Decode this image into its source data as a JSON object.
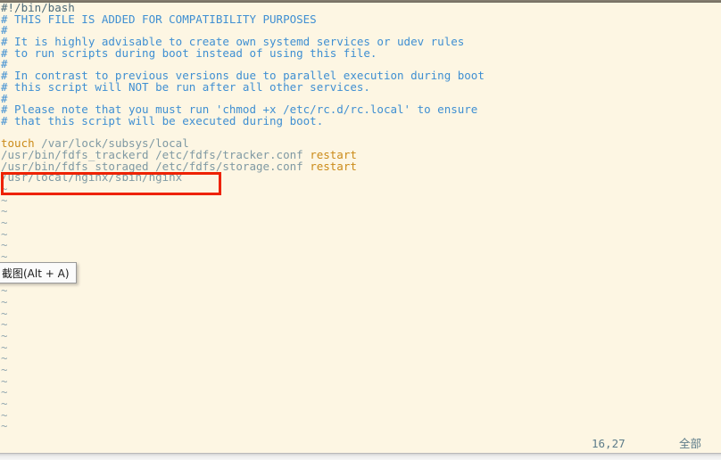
{
  "editor": {
    "name": "vim",
    "background_color": "#fdf6e3",
    "lines": [
      {
        "kind": "shebang",
        "text": "#!/bin/bash"
      },
      {
        "kind": "comment",
        "text": "# THIS FILE IS ADDED FOR COMPATIBILITY PURPOSES"
      },
      {
        "kind": "comment",
        "text": "#"
      },
      {
        "kind": "comment",
        "text": "# It is highly advisable to create own systemd services or udev rules"
      },
      {
        "kind": "comment",
        "text": "# to run scripts during boot instead of using this file."
      },
      {
        "kind": "comment",
        "text": "#"
      },
      {
        "kind": "comment",
        "text": "# In contrast to previous versions due to parallel execution during boot"
      },
      {
        "kind": "comment",
        "text": "# this script will NOT be run after all other services."
      },
      {
        "kind": "comment",
        "text": "#"
      },
      {
        "kind": "comment",
        "text": "# Please note that you must run 'chmod +x /etc/rc.d/rc.local' to ensure"
      },
      {
        "kind": "comment",
        "text": "# that this script will be executed during boot."
      },
      {
        "kind": "blank",
        "text": ""
      },
      {
        "kind": "command",
        "keyword": "touch",
        "rest": " /var/lock/subsys/local"
      },
      {
        "kind": "command",
        "keyword": "",
        "rest": "/usr/bin/fdfs_trackerd /etc/fdfs/tracker.conf ",
        "trailing_keyword": "restart"
      },
      {
        "kind": "command",
        "keyword": "",
        "rest": "/usr/bin/fdfs_storaged /etc/fdfs/storage.conf ",
        "trailing_keyword": "restart"
      },
      {
        "kind": "command",
        "keyword": "",
        "rest": "/usr/local/nginx/sbin/nginx",
        "trailing_keyword": ""
      }
    ],
    "empty_marker": "~",
    "empty_marker_count": 23,
    "colors": {
      "shebang": "#4c6a78",
      "comment": "#3f8fd2",
      "path": "#7f99a3",
      "keyword": "#cb8b19",
      "tilde": "#92a7b0"
    }
  },
  "annotation": {
    "shape": "rectangle",
    "color": "#ee2200",
    "target_text": "/usr/local/nginx/sbin/nginx"
  },
  "tooltip": {
    "label": "截图(Alt + A)"
  },
  "statusline": {
    "cursor_position": "16,27",
    "scroll_indicator": "全部"
  }
}
